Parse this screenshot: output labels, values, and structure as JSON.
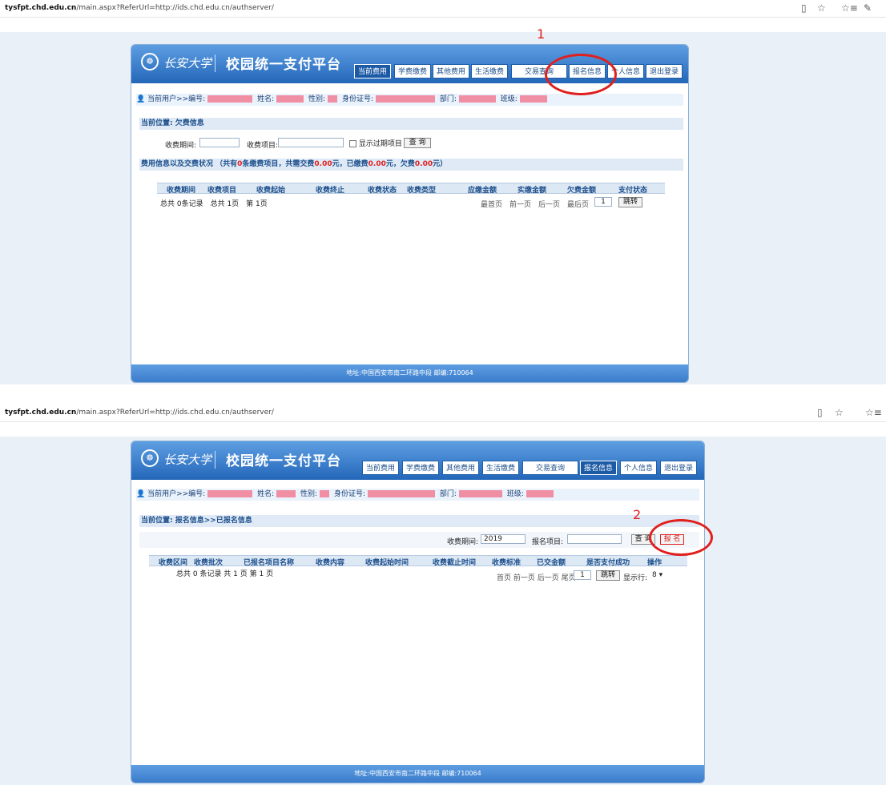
{
  "browser": {
    "url_host": "tysfpt.chd.edu.cn",
    "url_rest": "/main.aspx?ReferUrl=http://ids.chd.edu.cn/authserver/",
    "icons": [
      "reading-view-icon",
      "star-icon",
      "favorites-icon",
      "pen-icon"
    ]
  },
  "header": {
    "school_logo_text": "长安大学",
    "platform_title": "校园统一支付平台"
  },
  "nav": [
    "当前费用",
    "学费缴费",
    "其他费用",
    "生活缴费",
    "交易查询",
    "报名信息",
    "个人信息",
    "退出登录"
  ],
  "userbar": {
    "prefix": "当前用户>>编号:",
    "name_label": "姓名:",
    "gender_label": "性别:",
    "id_label": "身份证号:",
    "dept_label": "部门:",
    "class_label": "班级:"
  },
  "screen1": {
    "location": "当前位置: 欠费信息",
    "period_label": "收费期间:",
    "item_label": "收费项目:",
    "show_expired": "显示过期项目",
    "query_button": "查 询",
    "summary_prefix": "费用信息以及交费状况 （共有",
    "summary_count": "0",
    "summary_mid1": "条缴费项目，共需交费",
    "summary_total": "0.00",
    "summary_mid2": "元，已缴费",
    "summary_paid": "0.00",
    "summary_mid3": "元，欠费",
    "summary_owed": "0.00",
    "summary_suffix": "元）",
    "columns": [
      "收费期间",
      "收费项目",
      "收费起始",
      "收费终止",
      "收费状态",
      "收费类型",
      "应缴金额",
      "实缴金额",
      "欠费金额",
      "支付状态"
    ],
    "record_info": "总共 0条记录　总共 1页　第 1页",
    "pager": "最首页　前一页　后一页　最后页",
    "page_value": "1",
    "jump_button": "跳转",
    "annotation": "1"
  },
  "screen2": {
    "location": "当前位置: 报名信息>>已报名信息",
    "period_label": "收费期间:",
    "period_value": "2019",
    "item_label": "报名项目:",
    "query_button": "查 询",
    "signup_button": "报 名",
    "columns": [
      "收费区间",
      "收费批次",
      "已报名项目名称",
      "收费内容",
      "收费起始时间",
      "收费截止时间",
      "收费标准",
      "已交金额",
      "是否支付成功",
      "操作"
    ],
    "record_info": "总共 0 条记录 共 1 页 第 1 页",
    "pager": "首页 前一页 后一页 尾页",
    "page_value": "1",
    "jump_button": "跳转",
    "rows_label": "显示行:",
    "rows_value": "8",
    "annotation": "2"
  },
  "footer": "地址:中国西安市南二环路中段 邮编:710064",
  "colors": {
    "header": "#2d72c4",
    "annotation": "#e0201e",
    "redacted": "#f08ea3"
  }
}
